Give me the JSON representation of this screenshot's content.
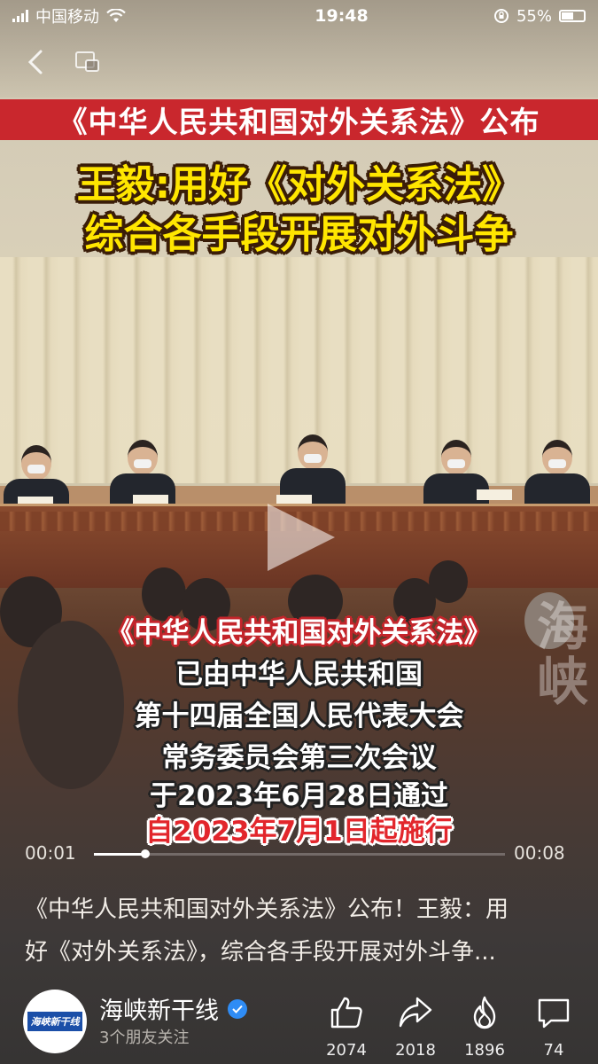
{
  "status_bar": {
    "carrier": "中国移动",
    "time": "19:48",
    "battery": "55%"
  },
  "video": {
    "headline_banner": "《中华人民共和国对外关系法》公布",
    "subtitle_line1": "王毅:用好《对外关系法》",
    "subtitle_line2": "综合各手段开展对外斗争",
    "watermark": "海峡",
    "captions": [
      "《中华人民共和国对外关系法》",
      "已由中华人民共和国",
      "第十四届全国人民代表大会",
      "常务委员会第三次会议",
      "于2023年6月28日通过",
      "自2023年7月1日起施行"
    ],
    "current_time": "00:01",
    "total_time": "00:08",
    "progress": 0.125
  },
  "description": {
    "line1": "《中华人民共和国对外关系法》公布！王毅：用",
    "line2": "好《对外关系法》，综合各手段开展对外斗争..."
  },
  "author": {
    "name": "海峡新干线",
    "followers": "3个朋友关注",
    "avatar_text": "海峡新干线"
  },
  "actions": {
    "like_count": "2074",
    "share_count": "2018",
    "hot_count": "1896",
    "comment_count": "74"
  },
  "colors": {
    "banner_red": "#c9272d",
    "subtitle_yellow": "#ffe600",
    "verified_blue": "#2f8cf5"
  }
}
